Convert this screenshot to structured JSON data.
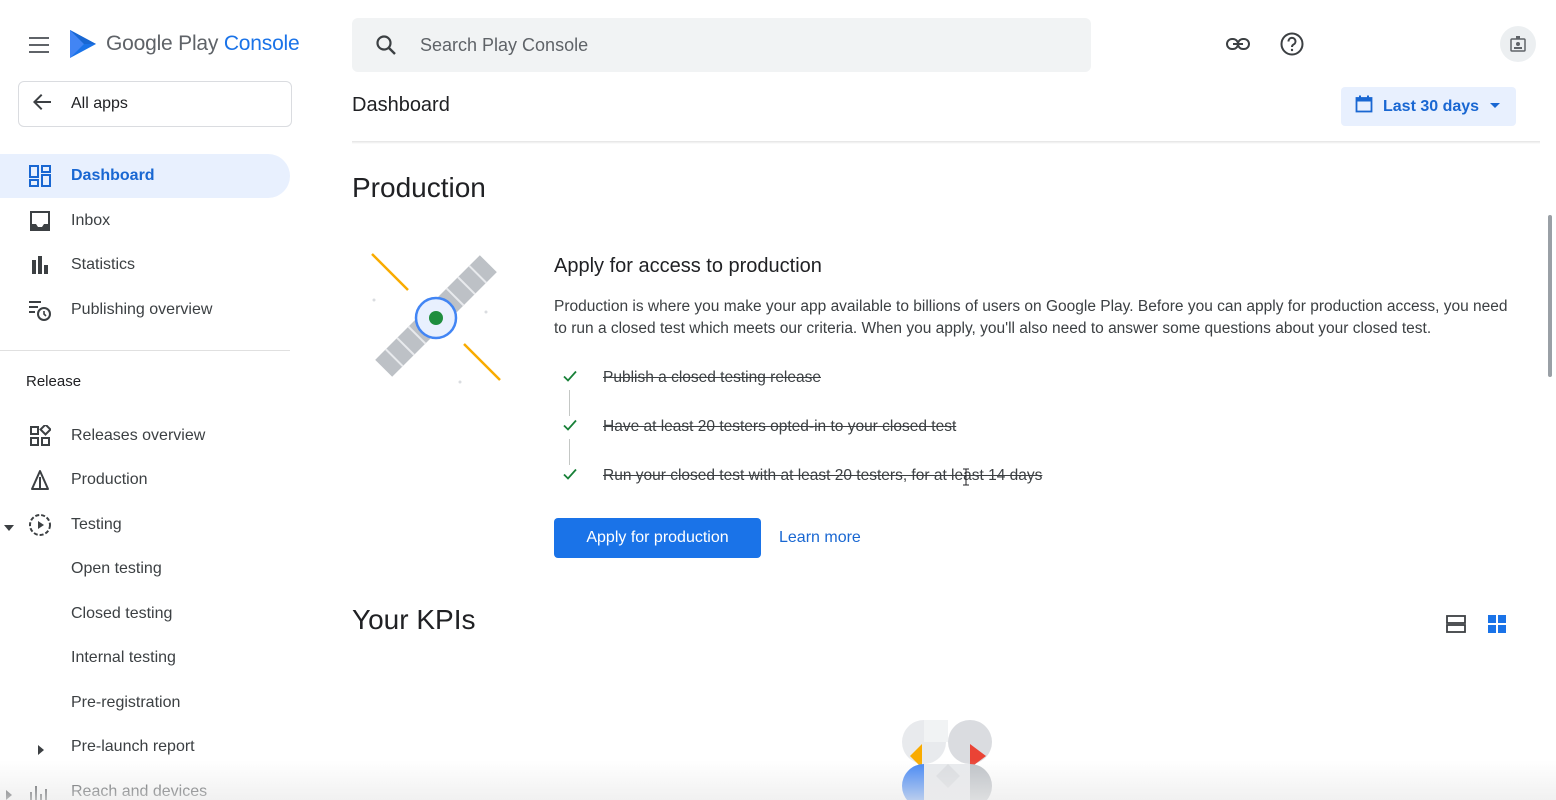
{
  "app": {
    "logo_text_primary": "Google Play",
    "logo_text_accent": "Console"
  },
  "sidebar": {
    "all_apps_label": "All apps",
    "items": [
      {
        "label": "Dashboard",
        "icon": "dashboard-icon",
        "active": true
      },
      {
        "label": "Inbox",
        "icon": "inbox-icon"
      },
      {
        "label": "Statistics",
        "icon": "bar-chart-icon"
      },
      {
        "label": "Publishing overview",
        "icon": "publishing-overview-icon"
      }
    ],
    "section_label": "Release",
    "release_items": [
      {
        "label": "Releases overview",
        "icon": "releases-overview-icon"
      },
      {
        "label": "Production",
        "icon": "production-icon"
      },
      {
        "label": "Testing",
        "icon": "testing-icon",
        "expanded": true
      },
      {
        "label": "Open testing"
      },
      {
        "label": "Closed testing"
      },
      {
        "label": "Internal testing"
      },
      {
        "label": "Pre-registration"
      },
      {
        "label": "Pre-launch report",
        "collapsed": true
      },
      {
        "label": "Reach and devices",
        "icon": "reach-devices-icon",
        "collapsed": true
      }
    ]
  },
  "header": {
    "search_placeholder": "Search Play Console",
    "page_title": "Dashboard",
    "date_range": "Last 30 days"
  },
  "production": {
    "heading": "Production",
    "title": "Apply for access to production",
    "description": "Production is where you make your app available to billions of users on Google Play. Before you can apply for production access, you need to run a closed test which meets our criteria. When you apply, you'll also need to answer some questions about your closed test.",
    "requirements": [
      "Publish a closed testing release",
      "Have at least 20 testers opted-in to your closed test",
      "Run your closed test with at least 20 testers, for at least 14 days"
    ],
    "apply_button": "Apply for production",
    "learn_more": "Learn more"
  },
  "kpis": {
    "heading": "Your KPIs"
  },
  "colors": {
    "accent": "#1a73e8",
    "active_bg": "#e8f0fe",
    "check": "#188038"
  }
}
